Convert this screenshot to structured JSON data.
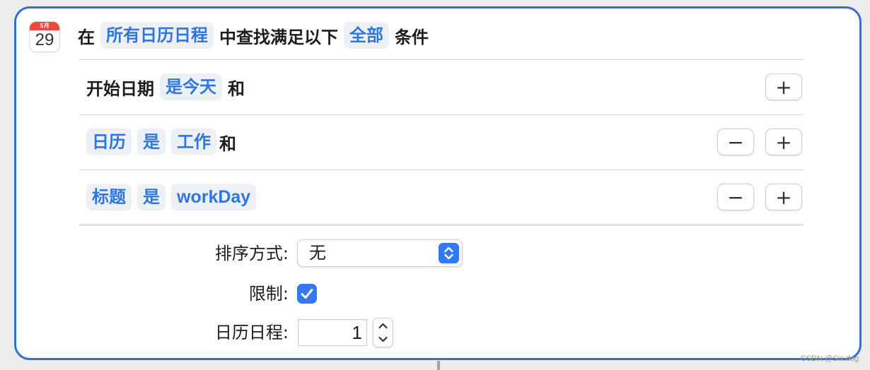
{
  "header": {
    "calendar_icon_month": "5月",
    "calendar_icon_day": "29",
    "prefix": "在",
    "source_value": "所有日历日程",
    "middle": "中查找满足以下",
    "match_value": "全部",
    "suffix": "条件"
  },
  "filters": [
    {
      "field": "开始日期",
      "operator": "是今天",
      "value": "",
      "conjunction": "和",
      "has_remove": false,
      "has_add": true
    },
    {
      "field": "日历",
      "operator": "是",
      "value": "工作",
      "conjunction": "和",
      "has_remove": true,
      "has_add": true
    },
    {
      "field": "标题",
      "operator": "是",
      "value": "workDay",
      "conjunction": "",
      "has_remove": true,
      "has_add": true
    }
  ],
  "buttons": {
    "add": "+",
    "remove": "−"
  },
  "options": {
    "sort_label": "排序方式:",
    "sort_value": "无",
    "limit_label": "限制:",
    "limit_checked": true,
    "count_label": "日历日程:",
    "count_value": "1"
  },
  "colors": {
    "accent": "#2f6fd8",
    "token_text": "#2f76e0",
    "token_bg": "#edf1f6",
    "control_blue": "#3478f6"
  },
  "watermark": "CSDN @Six.dog"
}
